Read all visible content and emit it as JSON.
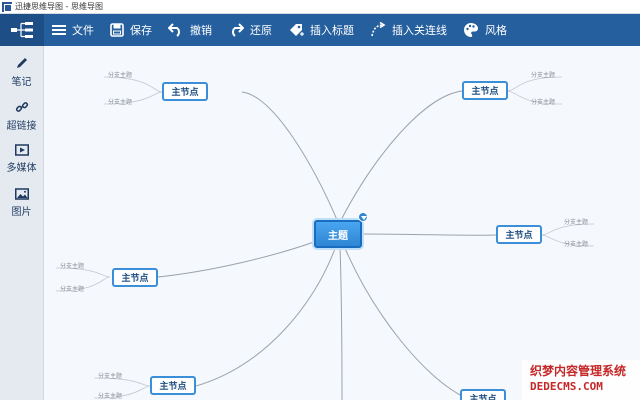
{
  "window": {
    "title": "迅捷思维导图 - 思维导图"
  },
  "toolbar": {
    "items": [
      {
        "label": "文件",
        "icon": "menu-icon"
      },
      {
        "label": "保存",
        "icon": "save-icon"
      },
      {
        "label": "撤销",
        "icon": "undo-icon"
      },
      {
        "label": "还原",
        "icon": "redo-icon"
      },
      {
        "label": "插入标题",
        "icon": "tag-icon"
      },
      {
        "label": "插入关连线",
        "icon": "relation-line-icon"
      },
      {
        "label": "风格",
        "icon": "palette-icon"
      }
    ]
  },
  "sidebar": {
    "items": [
      {
        "label": "笔记",
        "icon": "pencil-icon"
      },
      {
        "label": "超链接",
        "icon": "link-icon"
      },
      {
        "label": "多媒体",
        "icon": "media-icon"
      },
      {
        "label": "图片",
        "icon": "image-icon"
      }
    ]
  },
  "mindmap": {
    "center": "主题",
    "main_label": "主节点",
    "partial_label": "主节点",
    "sub_label": "分支主题"
  },
  "watermark": {
    "line1": "织梦内容管理系统",
    "line2": "DEDECMS.COM"
  },
  "colors": {
    "toolbar": "#255f9e",
    "accent": "#3a8fd8",
    "center": "#2f86d4"
  }
}
